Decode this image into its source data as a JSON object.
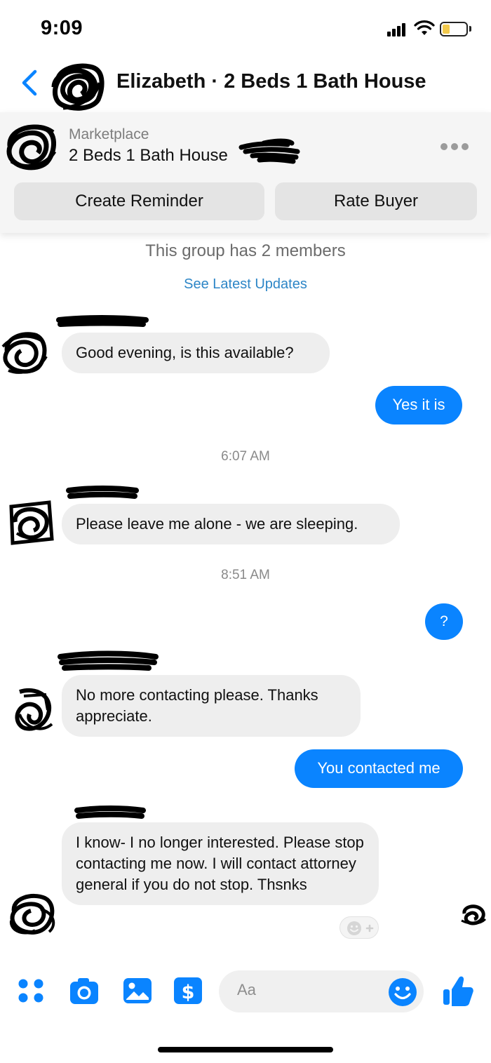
{
  "status_bar": {
    "time": "9:09"
  },
  "header": {
    "title": "Elizabeth · 2 Beds 1 Bath House"
  },
  "marketplace": {
    "kicker": "Marketplace",
    "listing_title": "2 Beds 1 Bath House",
    "actions": {
      "create_reminder": "Create Reminder",
      "rate_buyer": "Rate Buyer"
    }
  },
  "thread": {
    "group_note": "This group has 2 members",
    "updates_link": "See Latest Updates",
    "messages": [
      {
        "from": "them",
        "text": "Good evening, is this available?"
      },
      {
        "from": "me",
        "text": "Yes it is"
      },
      {
        "from": "system",
        "text": "6:07 AM"
      },
      {
        "from": "them",
        "text": "Please leave me alone - we are sleeping."
      },
      {
        "from": "system",
        "text": "8:51 AM"
      },
      {
        "from": "me",
        "text": "?"
      },
      {
        "from": "them",
        "text": "No more contacting please. Thanks appreciate."
      },
      {
        "from": "me",
        "text": "You contacted me"
      },
      {
        "from": "them",
        "text": "I know- I  no longer interested. Please stop contacting me now. I will contact attorney general if you do not stop. Thsnks"
      }
    ]
  },
  "composer": {
    "placeholder": "Aa"
  },
  "colors": {
    "accent": "#0a84ff",
    "incoming_bubble": "#eeeeee",
    "link": "#2d86c7"
  },
  "icons": [
    "back-chevron-icon",
    "more-icon",
    "apps-grid-icon",
    "camera-icon",
    "gallery-icon",
    "payment-icon",
    "emoji-icon",
    "thumbs-up-icon",
    "add-reaction-icon"
  ]
}
